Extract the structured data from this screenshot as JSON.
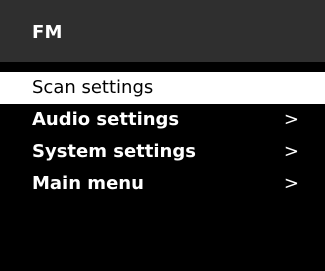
{
  "header": {
    "title": "FM"
  },
  "menu": {
    "items": [
      {
        "label": "Scan settings",
        "arrow": "",
        "selected": true
      },
      {
        "label": "Audio settings",
        "arrow": ">",
        "selected": false
      },
      {
        "label": "System settings",
        "arrow": ">",
        "selected": false
      },
      {
        "label": "Main menu",
        "arrow": ">",
        "selected": false
      }
    ]
  },
  "colors": {
    "screen_background": "#000000",
    "header_background": "#2f2f2f",
    "selected_background": "#ffffff",
    "text": "#ffffff",
    "selected_text": "#000000"
  }
}
